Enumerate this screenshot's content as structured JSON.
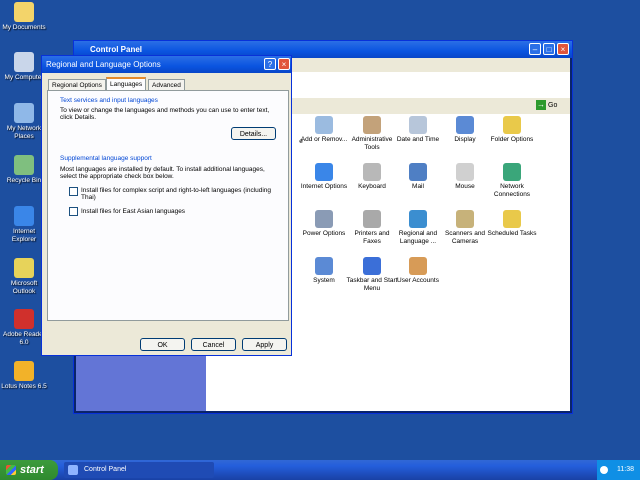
{
  "desktop": {
    "icons": [
      {
        "label": "My Documents"
      },
      {
        "label": "My Computer"
      },
      {
        "label": "My Network Places"
      },
      {
        "label": "Recycle Bin"
      },
      {
        "label": "Internet Explorer"
      },
      {
        "label": "Microsoft Outlook"
      },
      {
        "label": "Adobe Reader 6.0"
      },
      {
        "label": "Lotus Notes 6.5"
      }
    ]
  },
  "control_panel": {
    "title": "Control Panel",
    "address_go": "Go",
    "items": [
      {
        "label": "Add or Remov..."
      },
      {
        "label": "Administrative Tools"
      },
      {
        "label": "Date and Time"
      },
      {
        "label": "Display"
      },
      {
        "label": "Folder Options"
      },
      {
        "label": "Internet Options"
      },
      {
        "label": "Keyboard"
      },
      {
        "label": "Mail"
      },
      {
        "label": "Mouse"
      },
      {
        "label": "Network Connections"
      },
      {
        "label": "Power Options"
      },
      {
        "label": "Printers and Faxes"
      },
      {
        "label": "Regional and Language ..."
      },
      {
        "label": "Scanners and Cameras"
      },
      {
        "label": "Scheduled Tasks"
      },
      {
        "label": "System"
      },
      {
        "label": "Taskbar and Start Menu"
      },
      {
        "label": "User Accounts"
      }
    ],
    "partial_label": "e"
  },
  "dialog": {
    "title": "Regional and Language Options",
    "tabs": [
      "Regional Options",
      "Languages",
      "Advanced"
    ],
    "services": {
      "heading": "Text services and input languages",
      "text": "To view or change the languages and methods you can use to enter text, click Details.",
      "details_button": "Details..."
    },
    "supplemental": {
      "heading": "Supplemental language support",
      "text": "Most languages are installed by default. To install additional languages, select the appropriate check box below.",
      "check1": "Install files for complex script and right-to-left languages (including Thai)",
      "check2": "Install files for East Asian languages"
    },
    "buttons": {
      "ok": "OK",
      "cancel": "Cancel",
      "apply": "Apply"
    }
  },
  "taskbar": {
    "start": "start",
    "task": "Control Panel",
    "clock": "11:38"
  }
}
